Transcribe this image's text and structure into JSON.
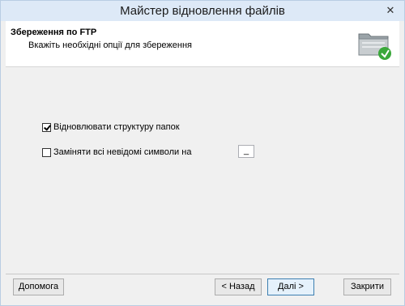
{
  "window": {
    "title": "Майстер відновлення файлів",
    "close_symbol": "✕"
  },
  "header": {
    "title": "Збереження по FTP",
    "subtitle": "Вкажіть необхідні опції для збереження",
    "icon": "folder-ftp-icon"
  },
  "options": {
    "restore_structure": {
      "label": "Відновлювати структуру папок",
      "checked": true
    },
    "replace_unknown": {
      "label": "Заміняти всі невідомі символи на",
      "checked": false,
      "value": "_"
    }
  },
  "buttons": {
    "help": "Допомога",
    "back": "< Назад",
    "next": "Далі >",
    "close": "Закрити"
  }
}
